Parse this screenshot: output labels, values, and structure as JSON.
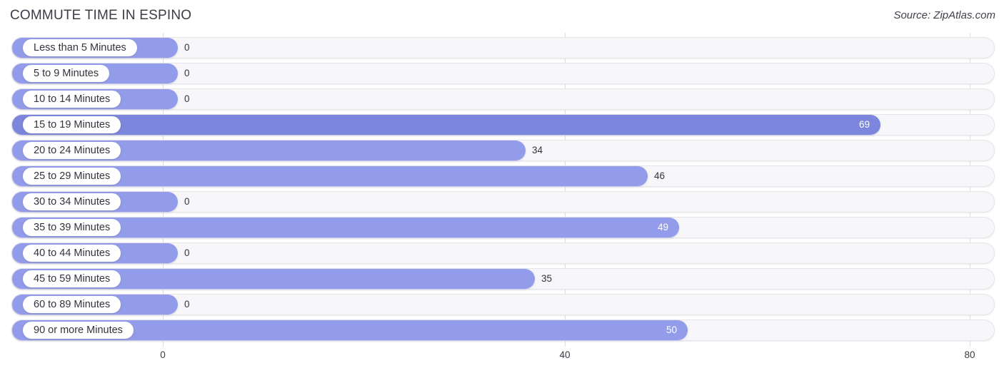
{
  "header": {
    "title": "COMMUTE TIME IN ESPINO",
    "source": "Source: ZipAtlas.com"
  },
  "chart_data": {
    "type": "bar",
    "orientation": "horizontal",
    "title": "COMMUTE TIME IN ESPINO",
    "xlabel": "",
    "ylabel": "",
    "xlim": [
      0,
      80
    ],
    "xticks": [
      0,
      40,
      80
    ],
    "xtick_labels": [
      "0",
      "40",
      "80"
    ],
    "grid": true,
    "legend": null,
    "categories": [
      "Less than 5 Minutes",
      "5 to 9 Minutes",
      "10 to 14 Minutes",
      "15 to 19 Minutes",
      "20 to 24 Minutes",
      "25 to 29 Minutes",
      "30 to 34 Minutes",
      "35 to 39 Minutes",
      "40 to 44 Minutes",
      "45 to 59 Minutes",
      "60 to 89 Minutes",
      "90 or more Minutes"
    ],
    "values": [
      0,
      0,
      0,
      69,
      34,
      46,
      0,
      49,
      0,
      35,
      0,
      50
    ],
    "value_labels": [
      "0",
      "0",
      "0",
      "69",
      "34",
      "46",
      "0",
      "49",
      "0",
      "35",
      "0",
      "50"
    ],
    "bar_color": "#929cea",
    "highlight_color": "#7b86dc",
    "track_color": "#f7f7f9"
  },
  "rows": [
    {
      "label": "Less than 5 Minutes",
      "value": "0",
      "bar_end": 248,
      "inside": false,
      "dark": false
    },
    {
      "label": "5 to 9 Minutes",
      "value": "0",
      "bar_end": 248,
      "inside": false,
      "dark": false
    },
    {
      "label": "10 to 14 Minutes",
      "value": "0",
      "bar_end": 248,
      "inside": false,
      "dark": false
    },
    {
      "label": "15 to 19 Minutes",
      "value": "69",
      "bar_end": 1232,
      "inside": true,
      "dark": true
    },
    {
      "label": "20 to 24 Minutes",
      "value": "34",
      "bar_end": 735,
      "inside": false,
      "dark": false
    },
    {
      "label": "25 to 29 Minutes",
      "value": "46",
      "bar_end": 906,
      "inside": false,
      "dark": false
    },
    {
      "label": "30 to 34 Minutes",
      "value": "0",
      "bar_end": 248,
      "inside": false,
      "dark": false
    },
    {
      "label": "35 to 39 Minutes",
      "value": "49",
      "bar_end": 950,
      "inside": true,
      "dark": false
    },
    {
      "label": "40 to 44 Minutes",
      "value": "0",
      "bar_end": 248,
      "inside": false,
      "dark": false
    },
    {
      "label": "45 to 59 Minutes",
      "value": "35",
      "bar_end": 748,
      "inside": false,
      "dark": false
    },
    {
      "label": "60 to 89 Minutes",
      "value": "0",
      "bar_end": 248,
      "inside": false,
      "dark": false
    },
    {
      "label": "90 or more Minutes",
      "value": "50",
      "bar_end": 962,
      "inside": true,
      "dark": false
    }
  ],
  "axis": {
    "ticks": [
      {
        "label": "0",
        "x": 228
      },
      {
        "label": "40",
        "x": 791
      },
      {
        "label": "80",
        "x": 1358
      }
    ]
  }
}
